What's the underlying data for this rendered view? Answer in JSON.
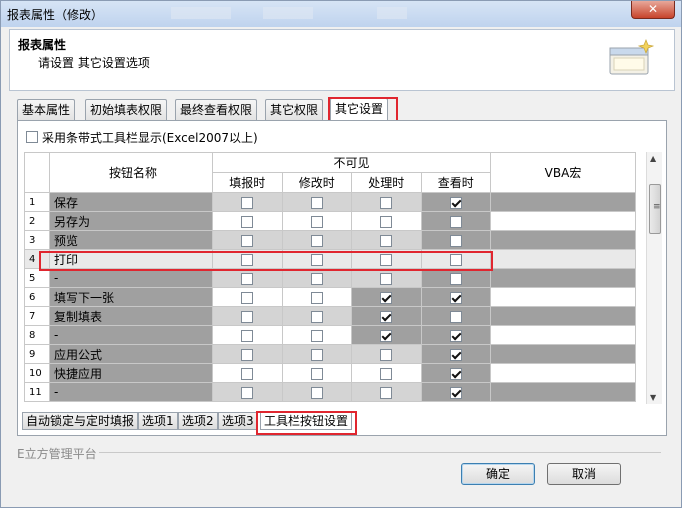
{
  "window": {
    "title": "报表属性（修改）",
    "close_symbol": "✕"
  },
  "header": {
    "title": "报表属性",
    "subtitle": "请设置 其它设置选项"
  },
  "top_tabs": [
    {
      "label": "基本属性",
      "active": false
    },
    {
      "label": "初始填表权限",
      "active": false
    },
    {
      "label": "最终查看权限",
      "active": false
    },
    {
      "label": "其它权限",
      "active": false
    },
    {
      "label": "其它设置",
      "active": true
    }
  ],
  "toolbar_option": {
    "label": "采用条带式工具栏显示(Excel2007以上)",
    "checked": false
  },
  "grid": {
    "header": {
      "name": "按钮名称",
      "invisible_group": "不可见",
      "columns": [
        "填报时",
        "修改时",
        "处理时",
        "查看时"
      ],
      "vba": "VBA宏"
    },
    "rows": [
      {
        "num": "1",
        "name": "保存",
        "checks": [
          false,
          false,
          false,
          true
        ],
        "shade": "light"
      },
      {
        "num": "2",
        "name": "另存为",
        "checks": [
          false,
          false,
          false,
          false
        ],
        "shade": "white"
      },
      {
        "num": "3",
        "name": "预览",
        "checks": [
          false,
          false,
          false,
          false
        ],
        "shade": "light"
      },
      {
        "num": "4",
        "name": "打印",
        "checks": [
          false,
          false,
          false,
          false
        ],
        "shade": "white",
        "highlight": true
      },
      {
        "num": "5",
        "name": "-",
        "checks": [
          false,
          false,
          false,
          false
        ],
        "shade": "light"
      },
      {
        "num": "6",
        "name": "填写下一张",
        "checks": [
          false,
          false,
          true,
          true
        ],
        "shade": "white"
      },
      {
        "num": "7",
        "name": "复制填表",
        "checks": [
          false,
          false,
          true,
          false
        ],
        "shade": "light"
      },
      {
        "num": "8",
        "name": "-",
        "checks": [
          false,
          false,
          true,
          true
        ],
        "shade": "white"
      },
      {
        "num": "9",
        "name": "应用公式",
        "checks": [
          false,
          false,
          false,
          true
        ],
        "shade": "light"
      },
      {
        "num": "10",
        "name": "快捷应用",
        "checks": [
          false,
          false,
          false,
          true
        ],
        "shade": "white"
      },
      {
        "num": "11",
        "name": "-",
        "checks": [
          false,
          false,
          false,
          true
        ],
        "shade": "light"
      }
    ]
  },
  "bottom_tabs": [
    {
      "label": "自动锁定与定时填报",
      "active": false
    },
    {
      "label": "选项1",
      "active": false
    },
    {
      "label": "选项2",
      "active": false
    },
    {
      "label": "选项3",
      "active": false
    },
    {
      "label": "工具栏按钮设置",
      "active": true
    }
  ],
  "footer": {
    "group_label": "E立方管理平台",
    "ok_label": "确定",
    "cancel_label": "取消"
  }
}
